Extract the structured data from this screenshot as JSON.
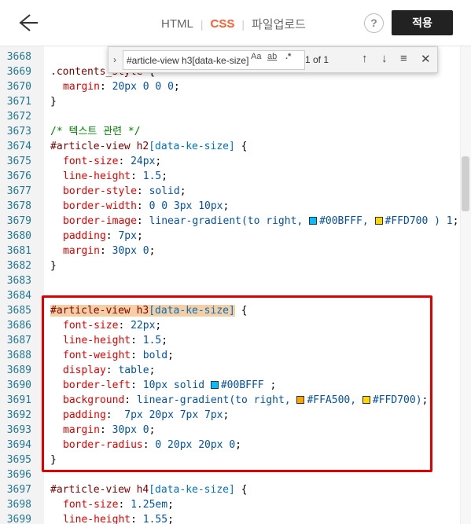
{
  "topbar": {
    "back_icon": "arrow-left-icon",
    "tabs": [
      {
        "label": "HTML",
        "active": false
      },
      {
        "label": "CSS",
        "active": true
      },
      {
        "label": "파일업로드",
        "active": false
      }
    ],
    "help_label": "?",
    "apply_label": "적용",
    "accent_color": "#ff5b2e"
  },
  "find_widget": {
    "query": "#article-view h3[data-ke-size]",
    "match_case_label": "Aa",
    "whole_word_label": "ab",
    "regex_label": ".*",
    "count_label": "1 of 1"
  },
  "swatches": {
    "c1": "#00BFFF",
    "c2": "#FFD700",
    "c3": "#00BFFF",
    "c4": "#FFA500",
    "c5": "#FFD700"
  },
  "lines": {
    "n3668": "3668",
    "n3669": "3669",
    "n3670": "3670",
    "n3671": "3671",
    "n3672": "3672",
    "n3673": "3673",
    "n3674": "3674",
    "n3675": "3675",
    "n3676": "3676",
    "n3677": "3677",
    "n3678": "3678",
    "n3679": "3679",
    "n3680": "3680",
    "n3681": "3681",
    "n3682": "3682",
    "n3683": "3683",
    "n3684": "3684",
    "n3685": "3685",
    "n3686": "3686",
    "n3687": "3687",
    "n3688": "3688",
    "n3689": "3689",
    "n3690": "3690",
    "n3691": "3691",
    "n3692": "3692",
    "n3693": "3693",
    "n3694": "3694",
    "n3695": "3695",
    "n3696": "3696",
    "n3697": "3697",
    "n3698": "3698",
    "n3699": "3699"
  },
  "code": {
    "l3669_sel": ".contents_style",
    "l3669_rest": " {",
    "l3670_prop": "margin",
    "l3670_val": " 20px 0 0 0",
    "close": "}",
    "l3673_cmt": "/* 텍스트 관련 */",
    "h2_sel_a": "#article-view h2",
    "h2_sel_b": "[data-ke-size]",
    "open": " {",
    "h2_p1": "font-size",
    "h2_v1": " 24px",
    "h2_p2": "line-height",
    "h2_v2": " 1.5",
    "h2_p3": "border-style",
    "h2_v3": " solid",
    "h2_p4": "border-width",
    "h2_v4": " 0 0 3px 10px",
    "h2_p5": "border-image",
    "h2_v5a": " linear-gradient(to right, ",
    "h2_v5b": "#00BFFF",
    "h2_v5c": ", ",
    "h2_v5d": "#FFD700",
    "h2_v5e": " ) 1",
    "h2_p6": "padding",
    "h2_v6": " 7px",
    "h2_p7": "margin",
    "h2_v7": " 30px 0",
    "h3_sel_a": "#article-view h3",
    "h3_sel_b": "[data-ke-size]",
    "h3_p1": "font-size",
    "h3_v1": " 22px",
    "h3_p2": "line-height",
    "h3_v2": " 1.5",
    "h3_p3": "font-weight",
    "h3_v3": " bold",
    "h3_p4": "display",
    "h3_v4": " table",
    "h3_p5": "border-left",
    "h3_v5a": " 10px solid ",
    "h3_v5b": "#00BFFF",
    "h3_v5c": " ",
    "h3_p6": "background",
    "h3_v6a": " linear-gradient(to right, ",
    "h3_v6b": "#FFA500",
    "h3_v6c": ", ",
    "h3_v6d": "#FFD700",
    "h3_v6e": ")",
    "h3_p7": "padding",
    "h3_v7": "  7px 20px 7px 7px",
    "h3_p8": "margin",
    "h3_v8": " 30px 0",
    "h3_p9": "border-radius",
    "h3_v9": " 0 20px 20px 0",
    "h4_sel_a": "#article-view h4",
    "h4_sel_b": "[data-ke-size]",
    "h4_p1": "font-size",
    "h4_v1": " 1.25em",
    "h4_p2": "line-height",
    "h4_v2": " 1.55"
  }
}
